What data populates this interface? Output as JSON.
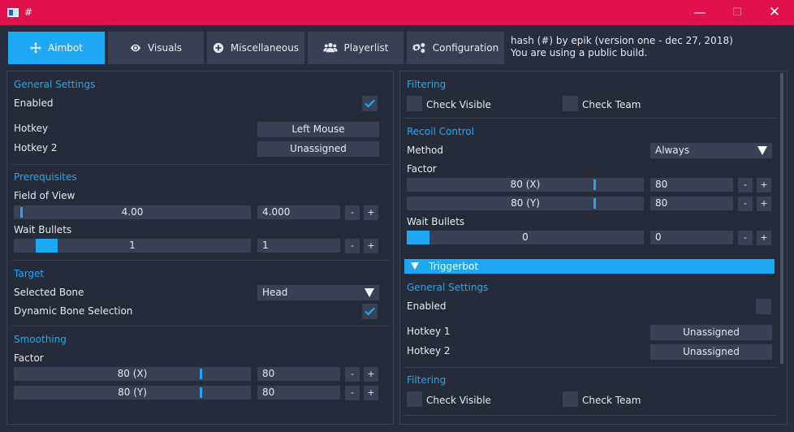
{
  "window": {
    "title": "#"
  },
  "tabs": [
    {
      "label": "Aimbot",
      "icon": "crosshair-icon"
    },
    {
      "label": "Visuals",
      "icon": "eye-icon"
    },
    {
      "label": "Miscellaneous",
      "icon": "plus-circle-icon"
    },
    {
      "label": "Playerlist",
      "icon": "users-icon"
    },
    {
      "label": "Configuration",
      "icon": "cogs-icon"
    }
  ],
  "info": {
    "line1": "hash (#) by epik (version one - dec 27, 2018)",
    "line2": "You are using a public build."
  },
  "colors": {
    "accent": "#1ea7f2",
    "titlebar": "#e0124d",
    "background": "#282d3d",
    "control": "#3a4053"
  },
  "left": {
    "general_settings": "General Settings",
    "enabled_label": "Enabled",
    "enabled_checked": true,
    "hotkey_label": "Hotkey",
    "hotkey_value": "Left Mouse",
    "hotkey2_label": "Hotkey 2",
    "hotkey2_value": "Unassigned",
    "prerequisites": "Prerequisites",
    "fov_label": "Field of View",
    "fov_slider": "4.00",
    "fov_input": "4.000",
    "wait_bullets_label": "Wait Bullets",
    "wait_bullets_slider": "1",
    "wait_bullets_input": "1",
    "target": "Target",
    "selected_bone_label": "Selected Bone",
    "selected_bone_value": "Head",
    "dynamic_bone_label": "Dynamic Bone Selection",
    "dynamic_bone_checked": true,
    "smoothing": "Smoothing",
    "factor_label": "Factor",
    "factor_x_slider": "80 (X)",
    "factor_x_input": "80",
    "factor_y_slider": "80 (Y)",
    "factor_y_input": "80"
  },
  "right": {
    "filtering": "Filtering",
    "check_visible": "Check Visible",
    "check_team": "Check Team",
    "recoil_control": "Recoil Control",
    "method_label": "Method",
    "method_value": "Always",
    "factor_label": "Factor",
    "factor_x_slider": "80 (X)",
    "factor_x_input": "80",
    "factor_y_slider": "80 (Y)",
    "factor_y_input": "80",
    "wait_bullets_label": "Wait Bullets",
    "wait_bullets_slider": "0",
    "wait_bullets_input": "0",
    "triggerbot": "Triggerbot",
    "tb_general_settings": "General Settings",
    "tb_enabled_label": "Enabled",
    "tb_enabled_checked": false,
    "tb_hotkey1_label": "Hotkey 1",
    "tb_hotkey1_value": "Unassigned",
    "tb_hotkey2_label": "Hotkey 2",
    "tb_hotkey2_value": "Unassigned",
    "tb_filtering": "Filtering",
    "tb_check_visible": "Check Visible",
    "tb_check_team": "Check Team"
  },
  "buttons": {
    "minus": "-",
    "plus": "+"
  },
  "window_buttons": {
    "minimize": "—",
    "maximize": "☐",
    "close": "✕"
  }
}
